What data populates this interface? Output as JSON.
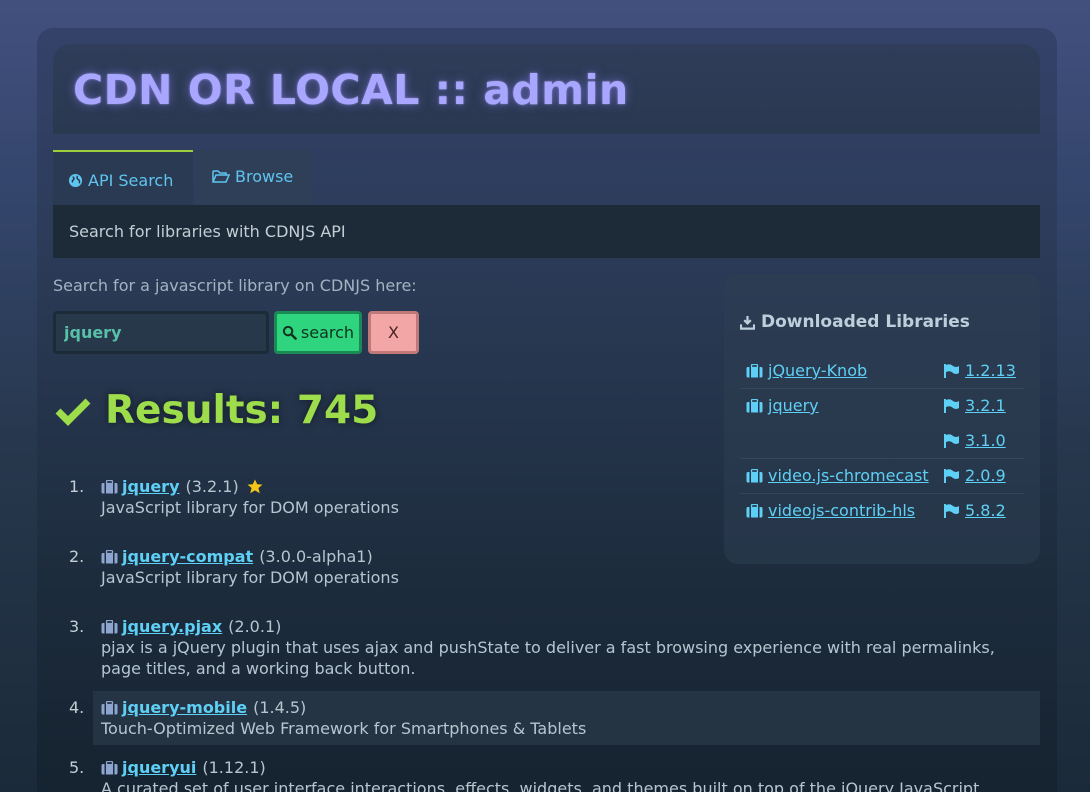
{
  "header": {
    "title": "CDN OR LOCAL :: admin"
  },
  "tabs": [
    {
      "label": "API Search",
      "icon": "globe-icon",
      "active": true
    },
    {
      "label": "Browse",
      "icon": "folder-open-icon",
      "active": false
    }
  ],
  "tab_panel": {
    "text": "Search for libraries with CDNJS API"
  },
  "search": {
    "prompt": "Search for a javascript library on CDNJS here:",
    "value": "jquery",
    "placeholder": "",
    "search_label": "search",
    "clear_label": "X"
  },
  "results": {
    "heading": "Results: 745",
    "items": [
      {
        "num": "1.",
        "name": "jquery",
        "version": "(3.2.1)",
        "starred": true,
        "desc": "JavaScript library for DOM operations"
      },
      {
        "num": "2.",
        "name": "jquery-compat",
        "version": "(3.0.0-alpha1)",
        "starred": false,
        "desc": "JavaScript library for DOM operations"
      },
      {
        "num": "3.",
        "name": "jquery.pjax",
        "version": "(2.0.1)",
        "starred": false,
        "desc": "pjax is a jQuery plugin that uses ajax and pushState to deliver a fast browsing experience with real permalinks, page titles, and a working back button."
      },
      {
        "num": "4.",
        "name": "jquery-mobile",
        "version": "(1.4.5)",
        "starred": false,
        "desc": "Touch-Optimized Web Framework for Smartphones & Tablets"
      },
      {
        "num": "5.",
        "name": "jqueryui",
        "version": "(1.12.1)",
        "starred": false,
        "desc": "A curated set of user interface interactions, effects, widgets, and themes built on top of the jQuery JavaScript Library."
      }
    ]
  },
  "sidebar": {
    "title": "Downloaded Libraries",
    "rows": [
      {
        "name": "jQuery-Knob",
        "version": "1.2.13"
      },
      {
        "name": "jquery",
        "version": "3.2.1"
      },
      {
        "name": "",
        "version": "3.1.0"
      },
      {
        "name": "video.js-chromecast",
        "version": "2.0.9"
      },
      {
        "name": "videojs-contrib-hls",
        "version": "5.8.2"
      }
    ]
  },
  "colors": {
    "title": "#a9a6ff",
    "link": "#5fd0f5",
    "results_heading": "#9ddc4a",
    "search_button": "#2ed47e",
    "clear_button": "#f2a6a6",
    "star": "#f5c518"
  }
}
